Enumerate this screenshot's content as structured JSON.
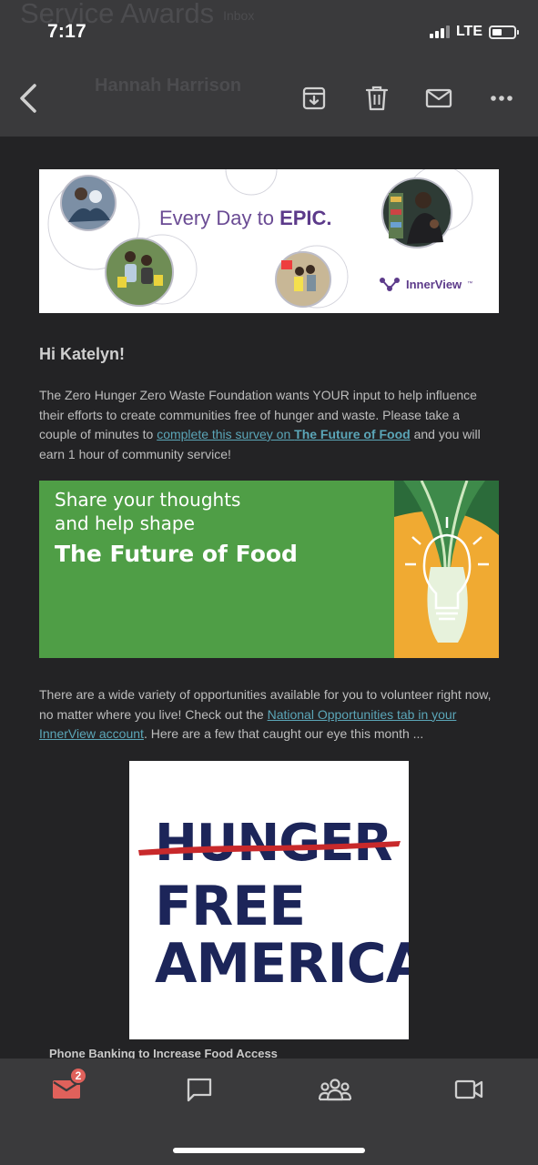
{
  "status_bar": {
    "time": "7:17",
    "network": "LTE",
    "battery_level": 0.45
  },
  "header": {
    "subject": "Service Awards",
    "subject_tag": "Inbox",
    "sender": "Hannah Harrison",
    "icons": [
      "back-chevron",
      "archive",
      "trash",
      "envelope",
      "more-horizontal"
    ]
  },
  "email": {
    "hero_banner": {
      "tagline_prefix": "Every Day to",
      "tagline_emphasis": "EPIC.",
      "brand": "InnerView",
      "brand_mark": "™"
    },
    "greeting": "Hi Katelyn!",
    "intro": {
      "text_before": "The Zero Hunger Zero Waste Foundation wants YOUR input to help influence their efforts to create communities free of hunger and waste. Please take a couple of minutes to ",
      "link_text": "complete this survey on ",
      "link_bold": "The Future of Food",
      "text_after": " and you will earn 1 hour of community service!"
    },
    "survey_banner": {
      "line1": "Share your thoughts",
      "line2": "and help shape",
      "title": "The Future of Food"
    },
    "opportunities": {
      "text_before": "There are a wide variety of opportunities available for you to volunteer right now, no matter where you live! Check out the ",
      "link_text": "National Opportunities tab in your InnerView account",
      "text_after": ". Here are a few that caught our eye this month ..."
    },
    "org_logo": {
      "word1": "HUNGER",
      "word2": "FREE",
      "word3": "AMERICA"
    },
    "next_item_partial": "Phone Banking to Increase Food Access"
  },
  "tab_bar": {
    "mail_badge": "2",
    "active_color": "#e0615b",
    "inactive_color": "#cfcfcf",
    "tabs": [
      "mail-icon",
      "chat-icon",
      "people-icon",
      "video-icon"
    ]
  }
}
